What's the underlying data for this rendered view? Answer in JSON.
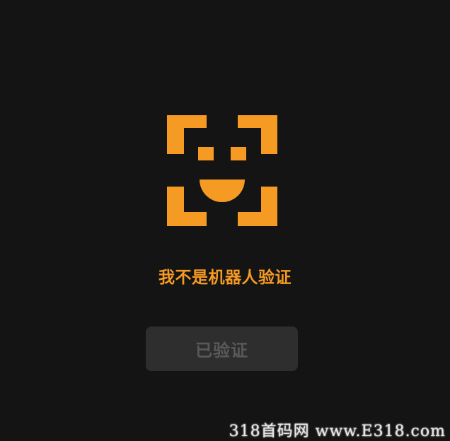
{
  "verification": {
    "icon": "smiley-face-scan-icon",
    "title": "我不是机器人验证",
    "button_label": "已验证",
    "button_state": "disabled"
  },
  "watermark": {
    "text": "318首码网 www.E318.com"
  },
  "colors": {
    "background": "#141414",
    "accent": "#f59a23",
    "button_bg": "#2e2e2e",
    "button_text": "#595959"
  }
}
